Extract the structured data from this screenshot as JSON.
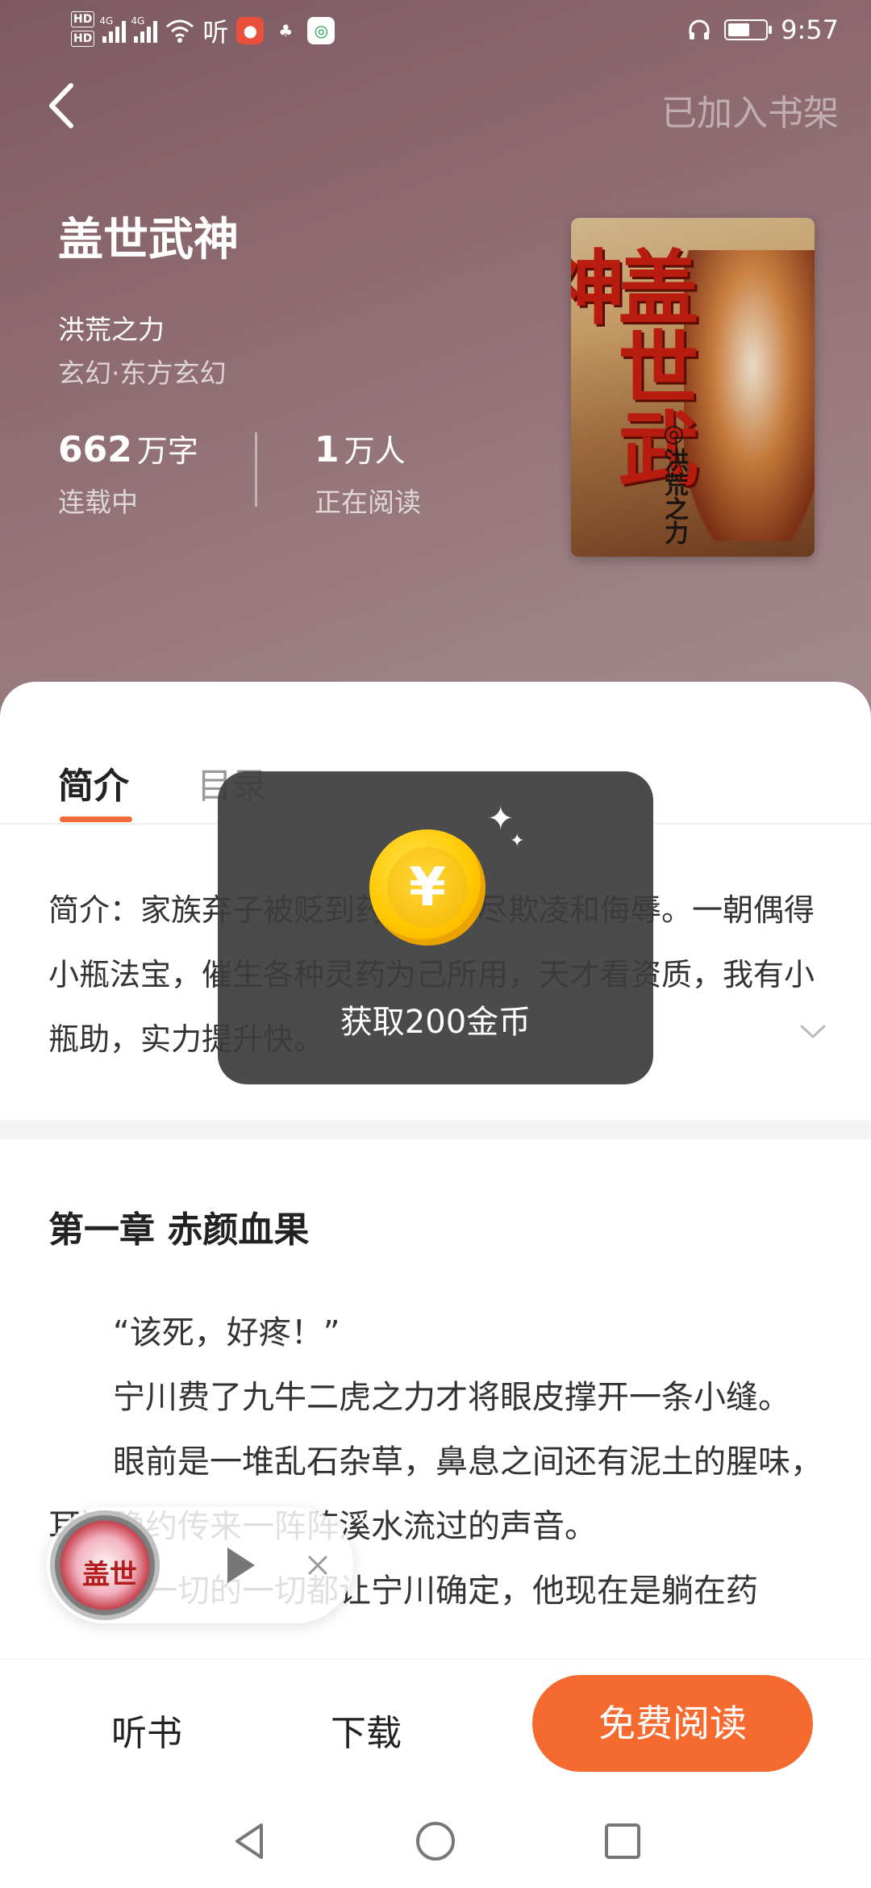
{
  "status_bar": {
    "network_left": "HD",
    "network_right": "HD",
    "signal_1": "4G",
    "signal_2": "4G",
    "listen_app": "听",
    "time": "9:57"
  },
  "header": {
    "back_icon": "chevron-left-icon",
    "shelf_label": "已加入书架"
  },
  "book": {
    "title": "盖世武神",
    "author": "洪荒之力",
    "category": "玄幻·东方玄幻",
    "word_count_num": "662",
    "word_count_unit": "万字",
    "status": "连载中",
    "readers_num": "1",
    "readers_unit": "万人",
    "readers_label": "正在阅读",
    "cover_title": "盖世武神",
    "cover_author": "◎洪荒之力"
  },
  "tabs": {
    "intro": "简介",
    "toc": "目录"
  },
  "synopsis": "简介：家族弃子被贬到药园，受尽欺凌和侮辱。一朝偶得小瓶法宝，催生各种灵药为己所用，天才看资质，我有小瓶助，实力提升快。",
  "chapter": {
    "title": "第一章 赤颜血果",
    "paragraphs": [
      "“该死，好疼！”",
      "宁川费了九牛二虎之力才将眼皮撑开一条小缝。",
      "眼前是一堆乱石杂草，鼻息之间还有泥土的腥味，耳边隐约传来一阵阵溪水流过的声音。",
      "这一切的一切都让宁川确定，他现在是躺在药"
    ]
  },
  "toast": {
    "coin_symbol": "¥",
    "text": "获取200金币"
  },
  "mini_player": {
    "cover_text": "盖世",
    "play_icon": "play-icon",
    "close_icon": "close-icon"
  },
  "actions": {
    "listen": "听书",
    "download": "下载",
    "read": "免费阅读"
  },
  "colors": {
    "accent": "#f46a2f",
    "tab_indicator": "#f26b3a",
    "hero_bg": "#8c6a70",
    "toast_bg": "#3c3c3c",
    "coin": "#ffc800"
  }
}
